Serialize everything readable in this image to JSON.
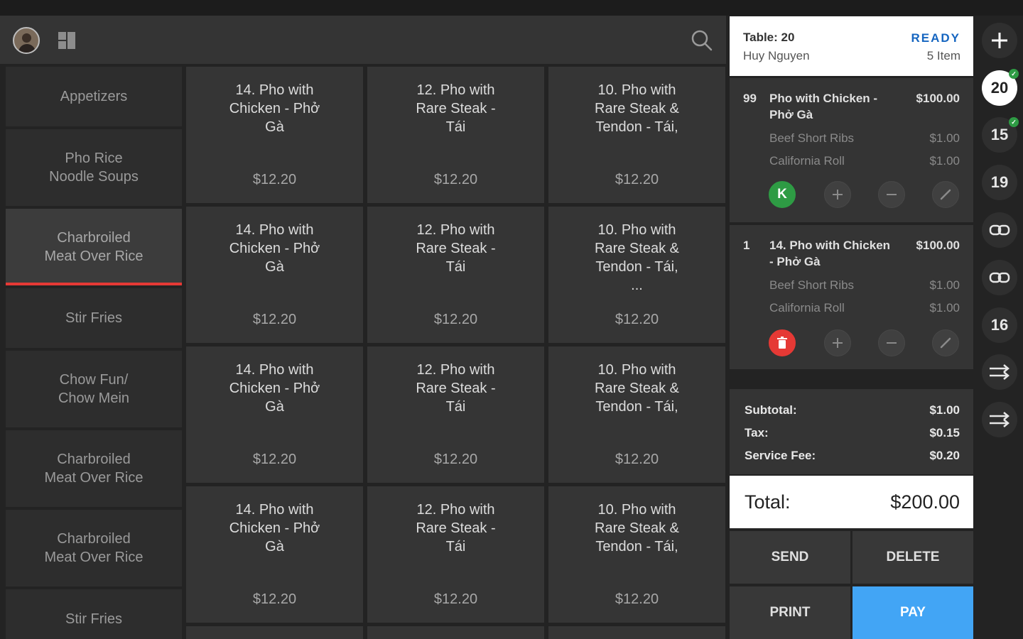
{
  "categories": [
    {
      "label": "Appetizers"
    },
    {
      "label": "Pho Rice\nNoodle Soups"
    },
    {
      "label": "Charbroiled\nMeat Over Rice",
      "active": true
    },
    {
      "label": "Stir Fries"
    },
    {
      "label": "Chow Fun/\nChow Mein"
    },
    {
      "label": "Charbroiled\nMeat Over Rice"
    },
    {
      "label": "Charbroiled\nMeat Over Rice"
    },
    {
      "label": "Stir Fries"
    }
  ],
  "products": [
    {
      "name": "14. Pho with\nChicken - Phở\nGà",
      "price": "$12.20"
    },
    {
      "name": "12. Pho with\nRare Steak -\nTái",
      "price": "$12.20"
    },
    {
      "name": "10. Pho with\nRare Steak &\nTendon - Tái,",
      "price": "$12.20"
    },
    {
      "name": "14. Pho with\nChicken - Phở\nGà",
      "price": "$12.20"
    },
    {
      "name": "12. Pho with\nRare Steak -\nTái",
      "price": "$12.20"
    },
    {
      "name": "10. Pho with\nRare Steak &\nTendon - Tái,\n...",
      "price": "$12.20"
    },
    {
      "name": "14. Pho with\nChicken - Phở\nGà",
      "price": "$12.20"
    },
    {
      "name": "12. Pho with\nRare Steak -\nTái",
      "price": "$12.20"
    },
    {
      "name": "10. Pho with\nRare Steak &\nTendon - Tái,",
      "price": "$12.20"
    },
    {
      "name": "14. Pho with\nChicken - Phở\nGà",
      "price": "$12.20"
    },
    {
      "name": "12. Pho with\nRare Steak -\nTái",
      "price": "$12.20"
    },
    {
      "name": "10. Pho with\nRare Steak &\nTendon - Tái,",
      "price": "$12.20"
    }
  ],
  "order": {
    "table": "Table: 20",
    "customer": "Huy Nguyen",
    "status": "READY",
    "item_count": "5 Item",
    "items": [
      {
        "qty": "99",
        "name": "Pho with Chicken -\nPhở Gà",
        "price": "$100.00",
        "modifiers": [
          {
            "name": "Beef Short Ribs",
            "price": "$1.00"
          },
          {
            "name": "California Roll",
            "price": "$1.00"
          }
        ],
        "status_label": "K"
      },
      {
        "qty": "1",
        "name": "14. Pho with Chicken\n- Phở Gà",
        "price": "$100.00",
        "modifiers": [
          {
            "name": "Beef Short Ribs",
            "price": "$1.00"
          },
          {
            "name": "California Roll",
            "price": "$1.00"
          }
        ]
      }
    ],
    "subtotal_label": "Subtotal:",
    "subtotal": "$1.00",
    "tax_label": "Tax:",
    "tax": "$0.15",
    "service_label": "Service Fee:",
    "service": "$0.20",
    "total_label": "Total:",
    "total": "$200.00"
  },
  "actions": {
    "send": "SEND",
    "delete": "DELETE",
    "print": "PRINT",
    "pay": "PAY"
  },
  "tables": [
    "20",
    "15",
    "19",
    "16"
  ],
  "colors": {
    "accent_red": "#e53935",
    "pay_blue": "#42a5f5",
    "ready_blue": "#1565c0",
    "kitchen_green": "#2e9b44"
  }
}
